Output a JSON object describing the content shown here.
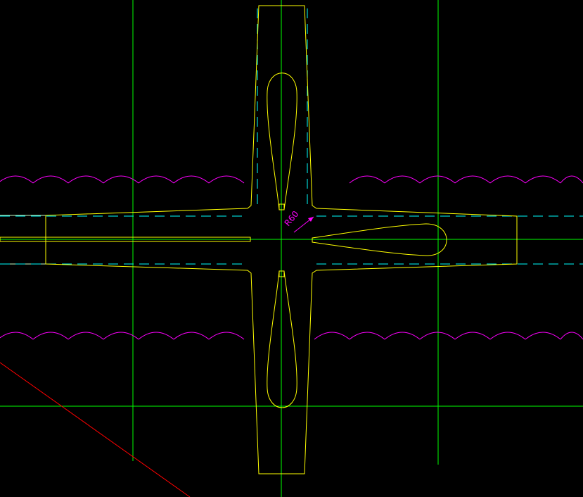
{
  "drawing": {
    "background": "#000000",
    "colors": {
      "outline": "#ffff00",
      "centerline": "#00ff00",
      "hidden": "#00ffff",
      "scallop": "#ff00ff",
      "dimension": "#ff00ff",
      "section_line": "#ff0000",
      "construction": "#c8ffc8"
    },
    "dimension": {
      "text": "R60"
    }
  }
}
